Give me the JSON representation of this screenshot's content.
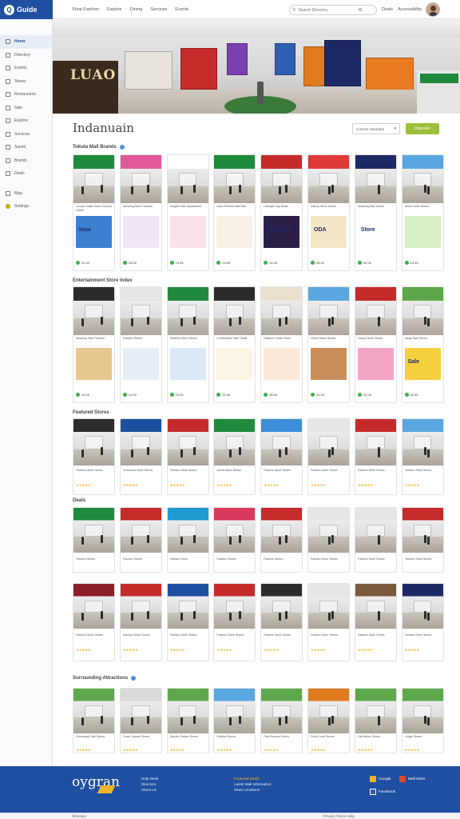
{
  "app": {
    "logo_text": "Guide",
    "logo_badge": "Q"
  },
  "topnav": [
    "Shop Fashion",
    "Explore",
    "Dining",
    "Services",
    "Events"
  ],
  "search": {
    "placeholder": "Search Directory"
  },
  "top_right": [
    "Deals",
    "Accessibility"
  ],
  "sidebar": {
    "items": [
      "Home",
      "Directory",
      "Events",
      "Stores",
      "Restaurants",
      "Sale",
      "Explore",
      "Services",
      "Saved",
      "Brands",
      "Deals",
      "Map",
      "Settings"
    ]
  },
  "hero": {
    "store_sign": "LUAO"
  },
  "page": {
    "title": "Indanuain",
    "filter_label": "Current Standard",
    "go_button": "Discover"
  },
  "sections": [
    {
      "title": "Tokuta Mall Brands"
    },
    {
      "title": "Entertainment Store Index"
    },
    {
      "title": "Featured Stores"
    },
    {
      "title": "Deals"
    },
    {
      "title": "Surrounding Attractions"
    }
  ],
  "rows": [
    {
      "cards": [
        {
          "caption": "Luxury Outlet Store Grocery Guide",
          "price": "20.00",
          "pic_color": "#3d7fd1",
          "pic_text": "toua"
        },
        {
          "caption": "Amazing Store Fashion",
          "price": "23.00",
          "pic_color": "#f2e6f6",
          "pic_text": ""
        },
        {
          "caption": "Singles Sale Department",
          "price": "13.99",
          "pic_color": "#fbe1ec",
          "pic_text": ""
        },
        {
          "caption": "Ultra Fashion Mall Mall",
          "price": "24.00",
          "pic_color": "#f6f1e4",
          "pic_text": ""
        },
        {
          "caption": "Lifestyle Day Deals",
          "price": "24.00",
          "pic_color": "#2b1f4a",
          "pic_text": "Seasons"
        },
        {
          "caption": "Disney Store Stores",
          "price": "28.00",
          "pic_color": "#f5e6c8",
          "pic_text": "ODA"
        },
        {
          "caption": "Amazing Sale Stores",
          "price": "32.00",
          "pic_color": "#ffffff",
          "pic_text": "Store"
        },
        {
          "caption": "Arena Store Stores",
          "price": "12.00",
          "pic_color": "#d9efc6",
          "pic_text": ""
        }
      ]
    },
    {
      "cards": [
        {
          "caption": "Amazing Sale Fashion",
          "price": "12.00",
          "pic_color": "#e8c78e",
          "pic_text": ""
        },
        {
          "caption": "Fashion Stores",
          "price": "12.00",
          "pic_color": "#e6eef7",
          "pic_text": ""
        },
        {
          "caption": "Gelatina Store Stores",
          "price": "23.00",
          "pic_color": "#dbe9f7",
          "pic_text": ""
        },
        {
          "caption": "Comfortable Sale Deals",
          "price": "22.00",
          "pic_color": "#fbf3e4",
          "pic_text": ""
        },
        {
          "caption": "Fashion Gelato Store",
          "price": "28.00",
          "pic_color": "#fbe9d7",
          "pic_text": ""
        },
        {
          "caption": "Home Deals Stores",
          "price": "24.00",
          "pic_color": "#c98e59",
          "pic_text": ""
        },
        {
          "caption": "Living Deals Stores",
          "price": "22.00",
          "pic_color": "#f4a5c6",
          "pic_text": ""
        },
        {
          "caption": "Mega Sale Stores",
          "price": "22.00",
          "pic_color": "#f4d03f",
          "pic_text": "Sale"
        }
      ]
    },
    {
      "cards": [
        {
          "caption": "Fashion Store Stores",
          "stars": "★★★★★"
        },
        {
          "caption": "Coolsmart Store Stores",
          "stars": "★★★★★"
        },
        {
          "caption": "Fashion Store Stores",
          "stars": "★★★★★"
        },
        {
          "caption": "Arena Store Stores",
          "stars": "★★★★★"
        },
        {
          "caption": "Fashion Store Stores",
          "stars": "★★★★★"
        },
        {
          "caption": "Fashion Store Stores",
          "stars": "★★★★★"
        },
        {
          "caption": "Fashion Store Stores",
          "stars": "★★★★★"
        },
        {
          "caption": "Fashion Store Stores",
          "stars": "★★★★★"
        }
      ]
    },
    {
      "cards": [
        {
          "caption": "Fashion Stores"
        },
        {
          "caption": "Fashion Stores"
        },
        {
          "caption": "Fashion Store"
        },
        {
          "caption": "Fashion Stores"
        },
        {
          "caption": "Fashion Stores"
        },
        {
          "caption": "Fashion Store Stores"
        },
        {
          "caption": "Fashion Store Stores"
        },
        {
          "caption": "Fashion Store Stores"
        }
      ]
    },
    {
      "cards": [
        {
          "caption": "Fashion Store Stores",
          "stars": "★★★★★"
        },
        {
          "caption": "Fashion Store Stores",
          "stars": "★★★★★"
        },
        {
          "caption": "Fashion Store Stores",
          "stars": "★★★★★"
        },
        {
          "caption": "Fashion Store Stores",
          "stars": "★★★★★"
        },
        {
          "caption": "Fashion Store Stores",
          "stars": "★★★★★"
        },
        {
          "caption": "Fashion Store Stores",
          "stars": "★★★★★"
        },
        {
          "caption": "Fashion Store Stores",
          "stars": "★★★★★"
        },
        {
          "caption": "Fashion Store Stores",
          "stars": "★★★★★"
        }
      ]
    },
    {
      "cards": [
        {
          "caption": "Greenway Park Stores",
          "stars": "★★★★★"
        },
        {
          "caption": "Tower Square Stores",
          "stars": "★★★★★"
        },
        {
          "caption": "Garden Palace Stores",
          "stars": "★★★★★"
        },
        {
          "caption": "Pavilion Stores",
          "stars": "★★★★★"
        },
        {
          "caption": "Park Avenue Stores",
          "stars": "★★★★★"
        },
        {
          "caption": "Food Court Stores",
          "stars": "★★★★★"
        },
        {
          "caption": "Old Manor Stores",
          "stars": "★★★★★"
        },
        {
          "caption": "Lodge Stores",
          "stars": "★★★★★"
        }
      ]
    }
  ],
  "footer": {
    "logo": "oygran",
    "links": [
      "Help Desk",
      "Directory",
      "About Us"
    ],
    "info_title": "Featured Deals",
    "info_lines": [
      "Latest Mall Information",
      "Store Locations"
    ],
    "badges": [
      "Google",
      "Mall Store",
      "Facebook"
    ],
    "badge_colors": [
      "#f0b429",
      "#d94b2b",
      "#3a5998"
    ]
  },
  "bottombar": {
    "left": "Directory",
    "right": "Privacy Terms Help"
  },
  "colors": {
    "brand": "#1f4fa0",
    "accent": "#9bbf3a",
    "price_dot": "#3fae49",
    "star": "#f0b429"
  }
}
